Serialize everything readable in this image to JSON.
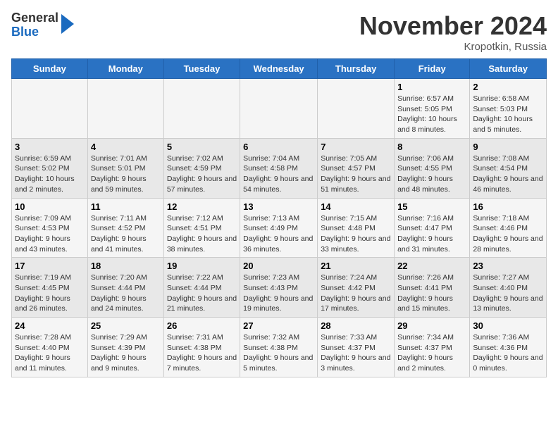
{
  "header": {
    "logo_general": "General",
    "logo_blue": "Blue",
    "month_title": "November 2024",
    "location": "Kropotkin, Russia"
  },
  "days_of_week": [
    "Sunday",
    "Monday",
    "Tuesday",
    "Wednesday",
    "Thursday",
    "Friday",
    "Saturday"
  ],
  "weeks": [
    [
      {
        "day": "",
        "info": ""
      },
      {
        "day": "",
        "info": ""
      },
      {
        "day": "",
        "info": ""
      },
      {
        "day": "",
        "info": ""
      },
      {
        "day": "",
        "info": ""
      },
      {
        "day": "1",
        "info": "Sunrise: 6:57 AM\nSunset: 5:05 PM\nDaylight: 10 hours and 8 minutes."
      },
      {
        "day": "2",
        "info": "Sunrise: 6:58 AM\nSunset: 5:03 PM\nDaylight: 10 hours and 5 minutes."
      }
    ],
    [
      {
        "day": "3",
        "info": "Sunrise: 6:59 AM\nSunset: 5:02 PM\nDaylight: 10 hours and 2 minutes."
      },
      {
        "day": "4",
        "info": "Sunrise: 7:01 AM\nSunset: 5:01 PM\nDaylight: 9 hours and 59 minutes."
      },
      {
        "day": "5",
        "info": "Sunrise: 7:02 AM\nSunset: 4:59 PM\nDaylight: 9 hours and 57 minutes."
      },
      {
        "day": "6",
        "info": "Sunrise: 7:04 AM\nSunset: 4:58 PM\nDaylight: 9 hours and 54 minutes."
      },
      {
        "day": "7",
        "info": "Sunrise: 7:05 AM\nSunset: 4:57 PM\nDaylight: 9 hours and 51 minutes."
      },
      {
        "day": "8",
        "info": "Sunrise: 7:06 AM\nSunset: 4:55 PM\nDaylight: 9 hours and 48 minutes."
      },
      {
        "day": "9",
        "info": "Sunrise: 7:08 AM\nSunset: 4:54 PM\nDaylight: 9 hours and 46 minutes."
      }
    ],
    [
      {
        "day": "10",
        "info": "Sunrise: 7:09 AM\nSunset: 4:53 PM\nDaylight: 9 hours and 43 minutes."
      },
      {
        "day": "11",
        "info": "Sunrise: 7:11 AM\nSunset: 4:52 PM\nDaylight: 9 hours and 41 minutes."
      },
      {
        "day": "12",
        "info": "Sunrise: 7:12 AM\nSunset: 4:51 PM\nDaylight: 9 hours and 38 minutes."
      },
      {
        "day": "13",
        "info": "Sunrise: 7:13 AM\nSunset: 4:49 PM\nDaylight: 9 hours and 36 minutes."
      },
      {
        "day": "14",
        "info": "Sunrise: 7:15 AM\nSunset: 4:48 PM\nDaylight: 9 hours and 33 minutes."
      },
      {
        "day": "15",
        "info": "Sunrise: 7:16 AM\nSunset: 4:47 PM\nDaylight: 9 hours and 31 minutes."
      },
      {
        "day": "16",
        "info": "Sunrise: 7:18 AM\nSunset: 4:46 PM\nDaylight: 9 hours and 28 minutes."
      }
    ],
    [
      {
        "day": "17",
        "info": "Sunrise: 7:19 AM\nSunset: 4:45 PM\nDaylight: 9 hours and 26 minutes."
      },
      {
        "day": "18",
        "info": "Sunrise: 7:20 AM\nSunset: 4:44 PM\nDaylight: 9 hours and 24 minutes."
      },
      {
        "day": "19",
        "info": "Sunrise: 7:22 AM\nSunset: 4:44 PM\nDaylight: 9 hours and 21 minutes."
      },
      {
        "day": "20",
        "info": "Sunrise: 7:23 AM\nSunset: 4:43 PM\nDaylight: 9 hours and 19 minutes."
      },
      {
        "day": "21",
        "info": "Sunrise: 7:24 AM\nSunset: 4:42 PM\nDaylight: 9 hours and 17 minutes."
      },
      {
        "day": "22",
        "info": "Sunrise: 7:26 AM\nSunset: 4:41 PM\nDaylight: 9 hours and 15 minutes."
      },
      {
        "day": "23",
        "info": "Sunrise: 7:27 AM\nSunset: 4:40 PM\nDaylight: 9 hours and 13 minutes."
      }
    ],
    [
      {
        "day": "24",
        "info": "Sunrise: 7:28 AM\nSunset: 4:40 PM\nDaylight: 9 hours and 11 minutes."
      },
      {
        "day": "25",
        "info": "Sunrise: 7:29 AM\nSunset: 4:39 PM\nDaylight: 9 hours and 9 minutes."
      },
      {
        "day": "26",
        "info": "Sunrise: 7:31 AM\nSunset: 4:38 PM\nDaylight: 9 hours and 7 minutes."
      },
      {
        "day": "27",
        "info": "Sunrise: 7:32 AM\nSunset: 4:38 PM\nDaylight: 9 hours and 5 minutes."
      },
      {
        "day": "28",
        "info": "Sunrise: 7:33 AM\nSunset: 4:37 PM\nDaylight: 9 hours and 3 minutes."
      },
      {
        "day": "29",
        "info": "Sunrise: 7:34 AM\nSunset: 4:37 PM\nDaylight: 9 hours and 2 minutes."
      },
      {
        "day": "30",
        "info": "Sunrise: 7:36 AM\nSunset: 4:36 PM\nDaylight: 9 hours and 0 minutes."
      }
    ]
  ]
}
